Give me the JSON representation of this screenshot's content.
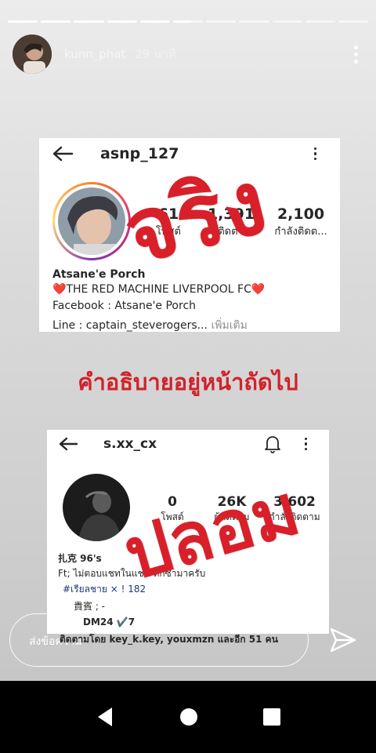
{
  "story": {
    "username": "kunn_phat",
    "time": "29 นาที",
    "progress_segments": 11,
    "completed_segments": 5,
    "caption": "คำอธิบายอยู่หน้าถัดไป"
  },
  "profile_real": {
    "username": "asnp_127",
    "stats": [
      {
        "value": "61",
        "label": "โพสต์"
      },
      {
        "value": "1,391",
        "label": "ผู้ติดตาม"
      },
      {
        "value": "2,100",
        "label": "กำลังติดต..."
      }
    ],
    "name": "Atsane'e Porch",
    "bio_line1": "❤️THE RED MACHINE LIVERPOOL FC❤️",
    "bio_line2": "Facebook : Atsane'e Porch",
    "bio_line3": "Line : captain_steverogers...",
    "more_link": "เพิ่มเติม",
    "stamp": "จริง"
  },
  "profile_fake": {
    "username": "s.xx_cx",
    "stats": [
      {
        "value": "0",
        "label": "โพสต์"
      },
      {
        "value": "26K",
        "label": "ผู้ติดตาม"
      },
      {
        "value": "3,602",
        "label": "กำลังติดตาม"
      }
    ],
    "name": "扎克 96's",
    "bio_line1": "Ft; ไม่ตอบแชทในแชท ทักซ้ำมาครับ",
    "bio_line2": "#เรียลชาย × ! 182",
    "bio_line3": "貴賓 ; -",
    "bio_line4": "DM24 ✔️7",
    "followed_by": "ติดตามโดย key_k.key, youxmzn และอีก 51 คน",
    "stamp": "ปลอม"
  },
  "reply": {
    "placeholder": "ส่งข้อความ"
  },
  "colors": {
    "stamp_red": "#d9202a",
    "card_bg": "#ffffff"
  }
}
